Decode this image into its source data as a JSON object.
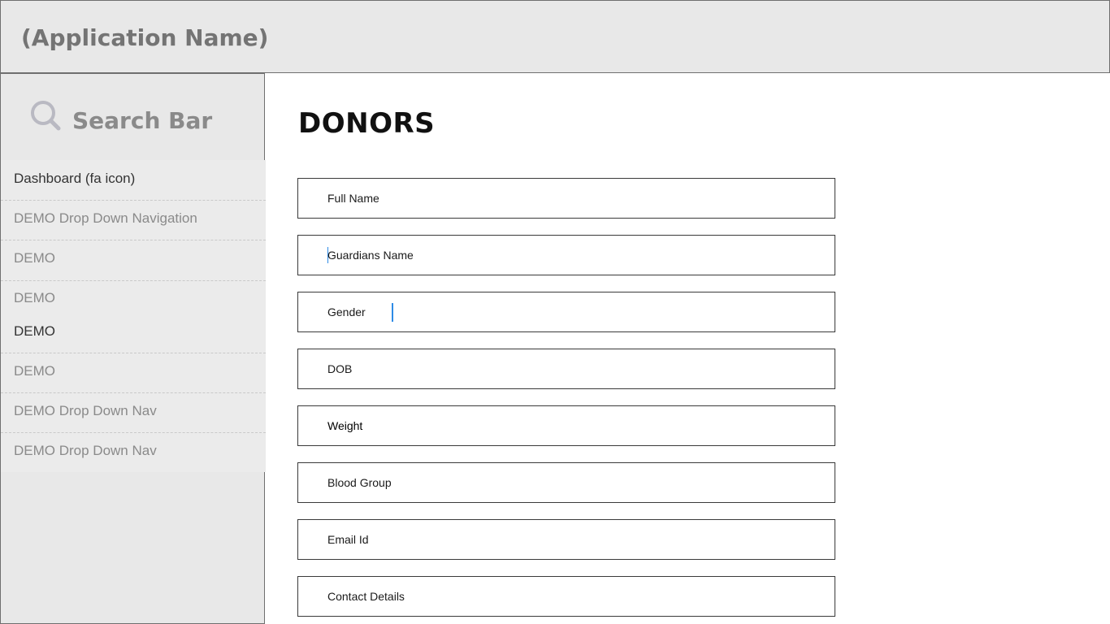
{
  "header": {
    "app_name": "(Application Name)"
  },
  "sidebar": {
    "search_label": "Search Bar",
    "search_icon": "search-icon",
    "items": [
      {
        "label": "Dashboard (fa icon)"
      },
      {
        "label": "DEMO Drop Down Navigation"
      },
      {
        "label": "DEMO"
      },
      {
        "label": "DEMO"
      },
      {
        "label": "DEMO"
      },
      {
        "label": "DEMO"
      },
      {
        "label": "DEMO Drop Down Nav"
      },
      {
        "label": "DEMO Drop Down Nav"
      }
    ]
  },
  "main": {
    "title": "DONORS",
    "fields": [
      {
        "label": "Full Name"
      },
      {
        "label": "Guardians Name"
      },
      {
        "label": "Gender"
      },
      {
        "label": "DOB"
      },
      {
        "label": "Weight"
      },
      {
        "label": "Blood Group"
      },
      {
        "label": "Email Id"
      },
      {
        "label": "Contact Details"
      }
    ]
  },
  "colors": {
    "panel_bg": "#e8e8e8",
    "caret": "#2e8be6"
  }
}
